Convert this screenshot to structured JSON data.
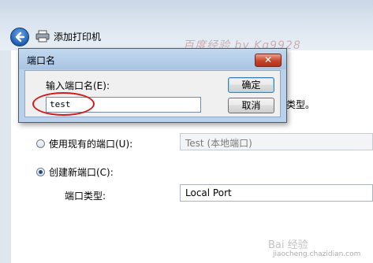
{
  "wizard": {
    "title": "添加打印机",
    "port_type_tail": "类型。",
    "use_existing_label": "使用现有的端口(U):",
    "existing_port_value": "Test (本地端口)",
    "create_new_label": "创建新端口(C):",
    "port_type_label": "端口类型:",
    "port_type_value": "Local Port",
    "selected_option": "create_new"
  },
  "dialog": {
    "title": "端口名",
    "close_glyph": "✕",
    "prompt_label": "输入端口名(E):",
    "input_value": "test",
    "ok_label": "确定",
    "cancel_label": "取消"
  },
  "watermark": "百度经验 by Kq9928",
  "footer": {
    "site_logo": "Bai 经验",
    "site_url": "jiaocheng.chazidian.com"
  },
  "colors": {
    "accent_blue": "#1f5fb3",
    "close_red": "#c7432a",
    "annotation_red": "#d21c1c",
    "dialog_frame": "#b9d1ea"
  }
}
